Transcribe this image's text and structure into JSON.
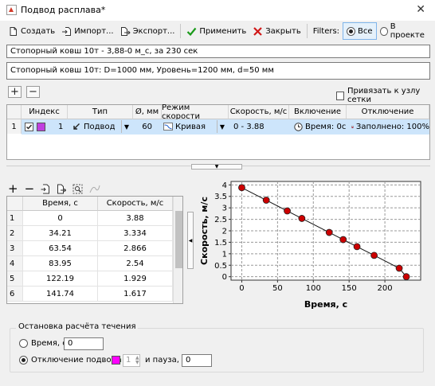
{
  "window": {
    "title": "Подвод расплава*"
  },
  "toolbar": {
    "create": "Создать",
    "import": "Импорт...",
    "export": "Экспорт...",
    "apply": "Применить",
    "close": "Закрыть",
    "filters_label": "Filters:",
    "filter_all": "Все",
    "filter_project": "В проекте",
    "filter_selected": "Все"
  },
  "name_field": {
    "value": "Стопорный ковш 10т - 3,88-0 м_с, за 230 сек"
  },
  "description_field": {
    "value": "Стопорный ковш 10т: D=1000 мм, Уровень=1200 мм, d=50 мм"
  },
  "grid_controls": {
    "snap_label": "Привязать к узлу сетки",
    "snap_checked": false
  },
  "sources_table": {
    "headers": {
      "index": "Индекс",
      "type": "Тип",
      "diameter": "Ø, мм",
      "speed_mode": "Режим скорости",
      "speed": "Скорость, м/с",
      "start": "Включение",
      "stop": "Отключение"
    },
    "rows": [
      {
        "row_num": "1",
        "checked": true,
        "color": "#c040e0",
        "index": "1",
        "type": "Подвод",
        "diameter": "60",
        "speed_mode": "Кривая",
        "speed": "0 - 3.88",
        "start": "Время: 0с",
        "stop": "Заполнено: 100%"
      }
    ]
  },
  "points_table": {
    "headers": {
      "time": "Время, с",
      "speed": "Скорость, м/с"
    },
    "rows": [
      {
        "n": "1",
        "time": "0",
        "speed": "3.88"
      },
      {
        "n": "2",
        "time": "34.21",
        "speed": "3.334"
      },
      {
        "n": "3",
        "time": "63.54",
        "speed": "2.866"
      },
      {
        "n": "4",
        "time": "83.95",
        "speed": "2.54"
      },
      {
        "n": "5",
        "time": "122.19",
        "speed": "1.929"
      },
      {
        "n": "6",
        "time": "141.74",
        "speed": "1.617"
      }
    ]
  },
  "chart_data": {
    "type": "line",
    "xlabel": "Время, с",
    "ylabel": "Скорость, м/с",
    "xlim": [
      -15,
      250
    ],
    "ylim": [
      -0.15,
      4.15
    ],
    "xticks": [
      0,
      50,
      100,
      150,
      200
    ],
    "yticks": [
      0,
      0.5,
      1,
      1.5,
      2,
      2.5,
      3,
      3.5,
      4
    ],
    "grid": true,
    "marker_color": "#cc0000",
    "x": [
      0,
      34.21,
      63.54,
      83.95,
      122.19,
      141.74,
      161.0,
      185.0,
      220.0,
      230.0
    ],
    "y": [
      3.88,
      3.334,
      2.866,
      2.54,
      1.929,
      1.617,
      1.31,
      0.93,
      0.37,
      0
    ]
  },
  "stop_section": {
    "title": "Остановка расчёта течения",
    "time_label": "Время, с",
    "time_value": "0",
    "shutoff_label": "Отключение подвода",
    "shutoff_selected": true,
    "color": "#ff00ff",
    "spinner_value": "1",
    "pause_label": "и пауза, с",
    "pause_value": "0"
  }
}
